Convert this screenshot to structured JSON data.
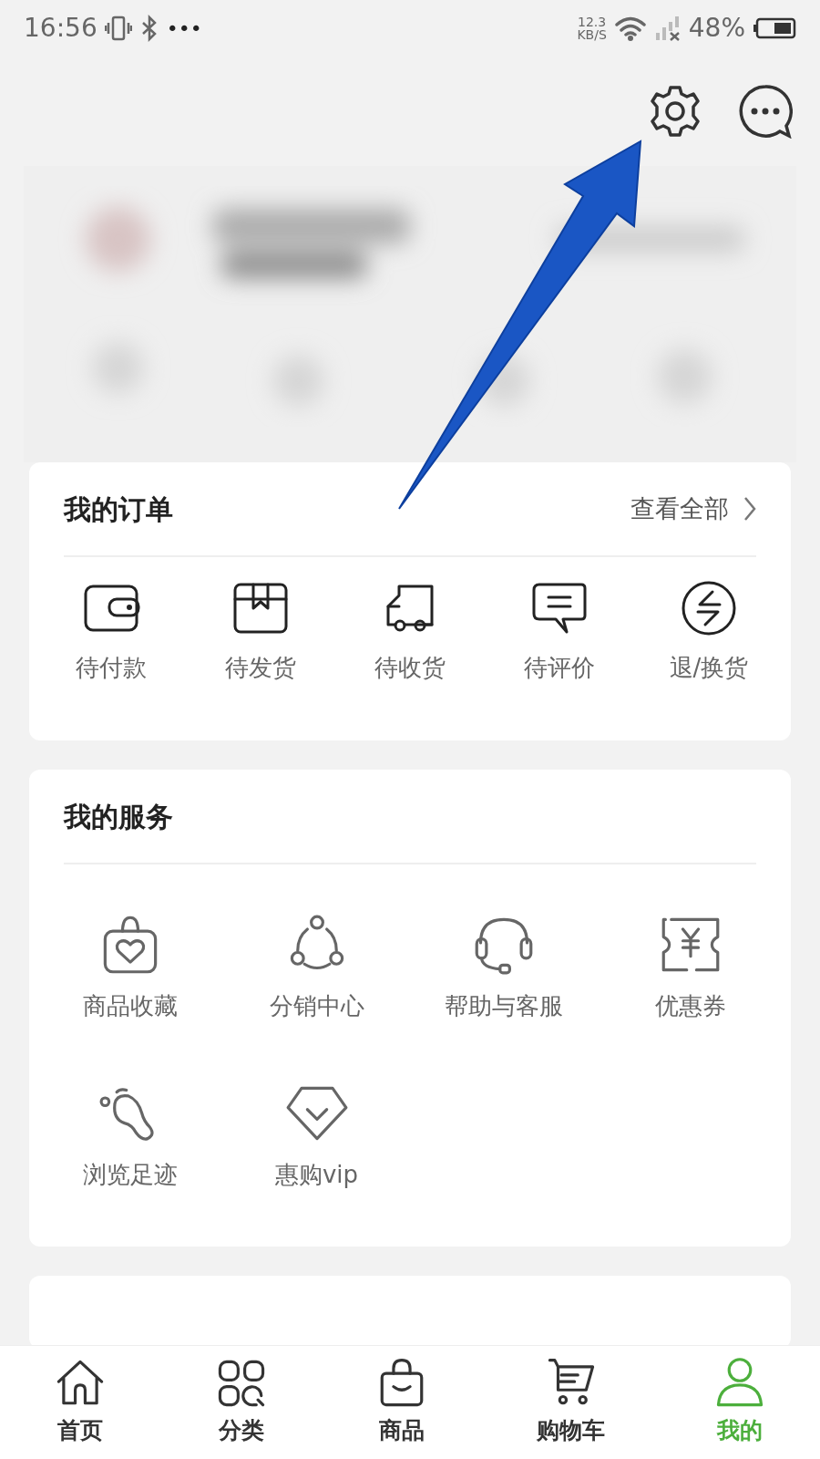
{
  "status_bar": {
    "time": "16:56",
    "more": "•••",
    "speed": "12.3",
    "speed_unit": "KB/S",
    "battery": "48%"
  },
  "orders": {
    "title": "我的订单",
    "view_all": "查看全部",
    "items": [
      {
        "label": "待付款"
      },
      {
        "label": "待发货"
      },
      {
        "label": "待收货"
      },
      {
        "label": "待评价"
      },
      {
        "label": "退/换货"
      }
    ]
  },
  "services": {
    "title": "我的服务",
    "items": [
      {
        "label": "商品收藏"
      },
      {
        "label": "分销中心"
      },
      {
        "label": "帮助与客服"
      },
      {
        "label": "优惠券"
      },
      {
        "label": "浏览足迹"
      },
      {
        "label": "惠购vip"
      }
    ]
  },
  "bottom_nav": [
    {
      "label": "首页",
      "selected": false
    },
    {
      "label": "分类",
      "selected": false
    },
    {
      "label": "商品",
      "selected": false
    },
    {
      "label": "购物车",
      "selected": false
    },
    {
      "label": "我的",
      "selected": true
    }
  ]
}
